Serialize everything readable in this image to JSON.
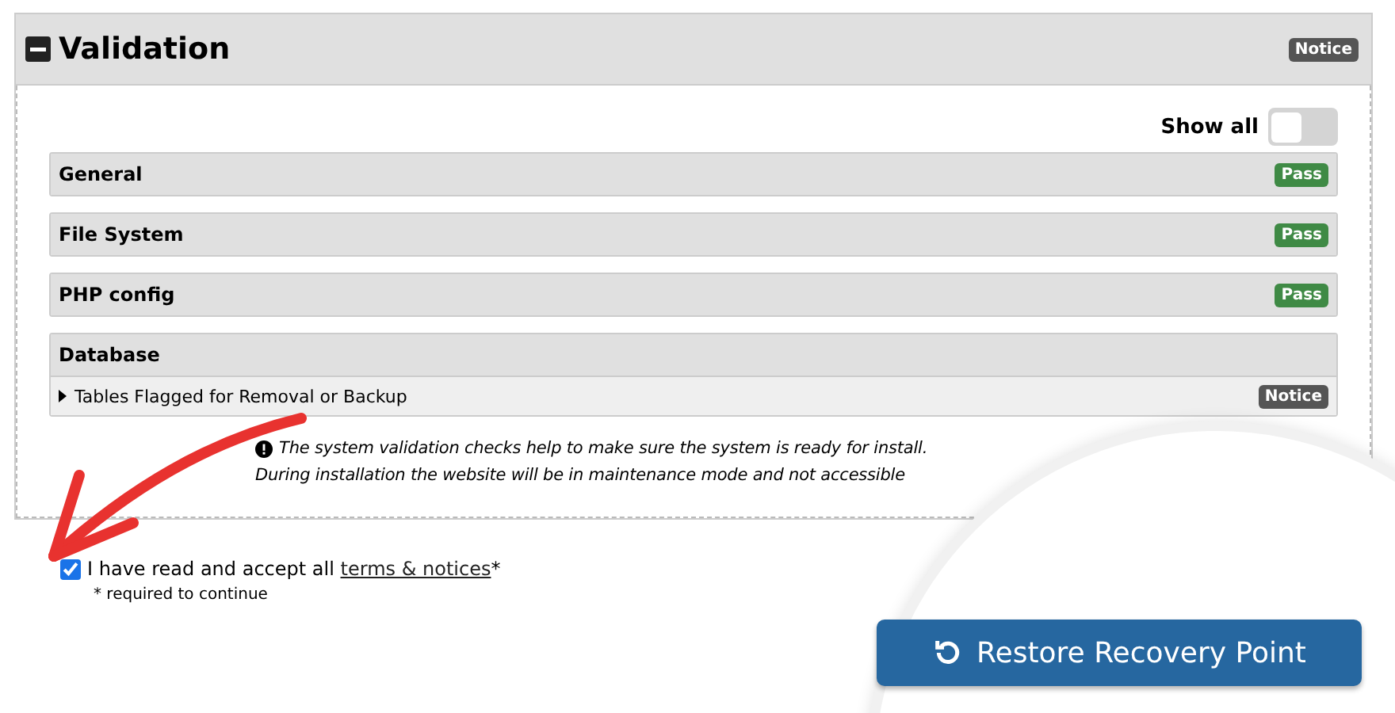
{
  "panel": {
    "title": "Validation",
    "expanded": true,
    "badge": {
      "label": "Notice",
      "color": "#555555"
    }
  },
  "show_all": {
    "label": "Show all",
    "on": false
  },
  "checks": [
    {
      "title": "General",
      "badge": {
        "label": "Pass",
        "color": "#3f8a45"
      }
    },
    {
      "title": "File System",
      "badge": {
        "label": "Pass",
        "color": "#3f8a45"
      }
    },
    {
      "title": "PHP config",
      "badge": {
        "label": "Pass",
        "color": "#3f8a45"
      }
    },
    {
      "title": "Database",
      "items": [
        {
          "label": "Tables Flagged for Removal or Backup",
          "expanded": false,
          "badge": {
            "label": "Notice",
            "color": "#555555"
          }
        }
      ]
    }
  ],
  "info": [
    "The system validation checks help to make sure the system is ready for install.",
    "During installation the website will be in maintenance mode and not accessible"
  ],
  "accept": {
    "checked": true,
    "text_before": "I have read and accept all",
    "link": "terms & notices",
    "text_after": "*",
    "note": "* required to continue"
  },
  "button": {
    "label": "Restore Recovery Point"
  }
}
